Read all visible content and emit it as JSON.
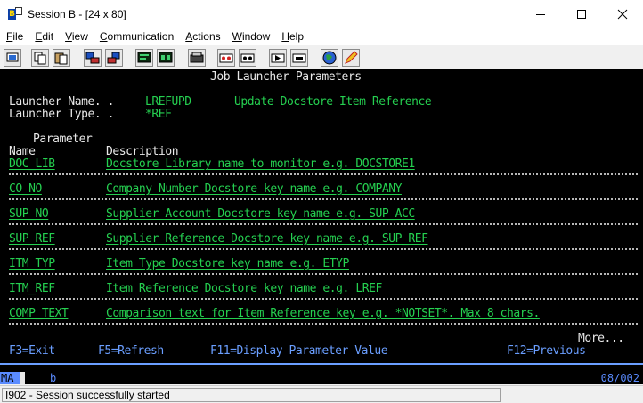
{
  "window": {
    "title": "Session B - [24 x 80]",
    "app_icon": "pcomm-session-icon",
    "controls": {
      "minimize": "—",
      "maximize": "☐",
      "close": "✕"
    }
  },
  "menu": {
    "items": [
      {
        "underline": "F",
        "rest": "ile"
      },
      {
        "underline": "E",
        "rest": "dit"
      },
      {
        "underline": "V",
        "rest": "iew"
      },
      {
        "underline": "C",
        "rest": "ommunication"
      },
      {
        "underline": "A",
        "rest": "ctions"
      },
      {
        "underline": "W",
        "rest": "indow"
      },
      {
        "underline": "H",
        "rest": "elp"
      }
    ]
  },
  "toolbar": {
    "buttons": [
      "print-screen-icon",
      "copy-icon",
      "paste-icon",
      "send-file-icon",
      "receive-file-icon",
      "display-icon",
      "keyboard-icon",
      "settings-icon",
      "record-macro-icon",
      "stop-macro-icon",
      "play-macro-icon",
      "macro-list-icon",
      "globe-icon",
      "pencil-icon"
    ]
  },
  "terminal": {
    "screen_title": "Job Launcher Parameters",
    "launcher_name_label": "Launcher Name. . ",
    "launcher_name_value": "LREFUPD",
    "launcher_description": "Update Docstore Item Reference",
    "launcher_type_label": "Launcher Type. . ",
    "launcher_type_value": "*REF",
    "col_parameter": "Parameter",
    "col_name": "Name",
    "col_description": "Description",
    "parameters": [
      {
        "name": "DOC_LIB",
        "description": "Docstore Library name to monitor e.g. DOCSTORE1"
      },
      {
        "name": "CO_NO",
        "description": "Company Number Docstore key name e.g. COMPANY"
      },
      {
        "name": "SUP_NO",
        "description": "Supplier Account Docstore key name e.g. SUP_ACC"
      },
      {
        "name": "SUP_REF",
        "description": "Supplier Reference Docstore key name e.g. SUP_REF"
      },
      {
        "name": "ITM_TYP",
        "description": "Item Type Docstore key name e.g. ETYP"
      },
      {
        "name": "ITM_REF",
        "description": "Item Reference Docstore key name e.g. LREF"
      },
      {
        "name": "COMP_TEXT",
        "description": "Comparison text for Item Reference key e.g. *NOTSET*. Max 8 chars."
      }
    ],
    "more_indicator": "More...",
    "fkeys": {
      "f3": "F3=Exit",
      "f5": "F5=Refresh",
      "f11": "F11=Display Parameter Value",
      "f12": "F12=Previous"
    }
  },
  "oia": {
    "mode": "MA",
    "session_letter": "b",
    "cursor_position": "08/002"
  },
  "status": {
    "message": "I902 - Session successfully started"
  },
  "colors": {
    "terminal_bg": "#000000",
    "green": "#25d050",
    "blue": "#6a9eff",
    "turquoise": "#3fd3d3",
    "white": "#e8e8e8"
  }
}
